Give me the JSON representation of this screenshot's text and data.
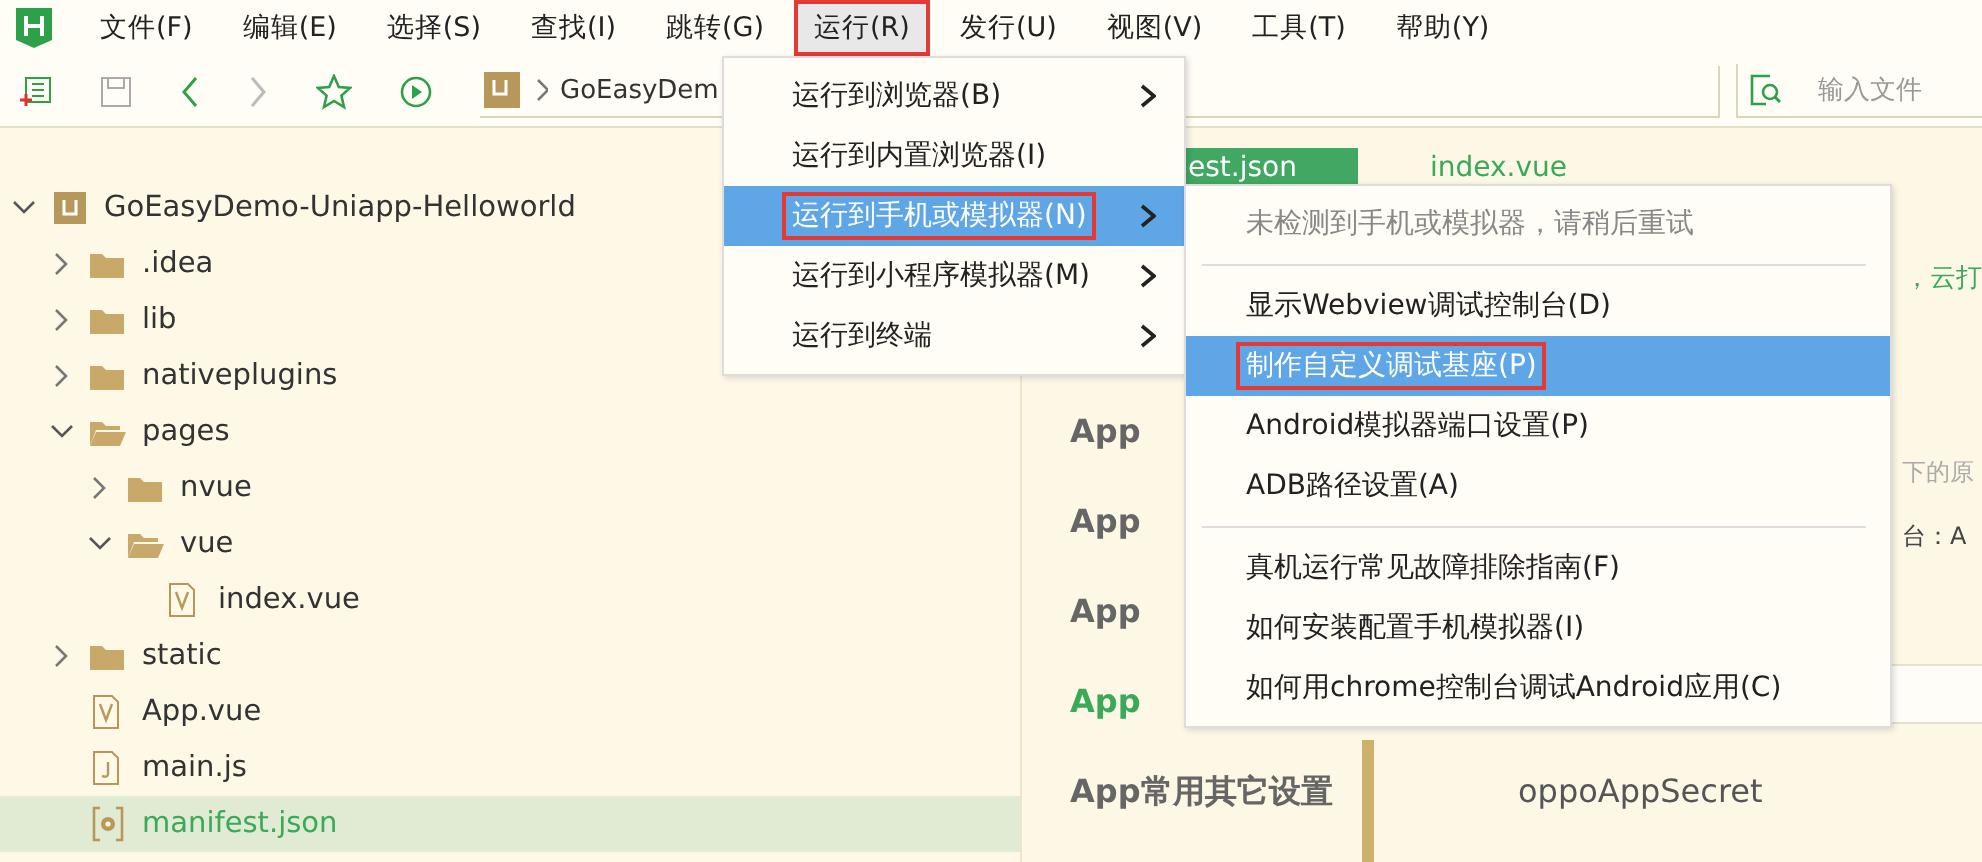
{
  "menubar": [
    {
      "label": "文件(F)",
      "selected": false,
      "highlighted": false
    },
    {
      "label": "编辑(E)",
      "selected": false,
      "highlighted": false
    },
    {
      "label": "选择(S)",
      "selected": false,
      "highlighted": false
    },
    {
      "label": "查找(I)",
      "selected": false,
      "highlighted": false
    },
    {
      "label": "跳转(G)",
      "selected": false,
      "highlighted": false
    },
    {
      "label": "运行(R)",
      "selected": true,
      "highlighted": true
    },
    {
      "label": "发行(U)",
      "selected": false,
      "highlighted": false
    },
    {
      "label": "视图(V)",
      "selected": false,
      "highlighted": false
    },
    {
      "label": "工具(T)",
      "selected": false,
      "highlighted": false
    },
    {
      "label": "帮助(Y)",
      "selected": false,
      "highlighted": false
    }
  ],
  "toolbar": {
    "breadcrumb": "GoEasyDem",
    "search": {
      "placeholder": "输入文件"
    }
  },
  "project_tree": [
    {
      "label": "GoEasyDemo-Uniapp-Helloworld",
      "kind": "project",
      "expanded": true,
      "selected": false,
      "children": [
        {
          "label": ".idea",
          "kind": "folder",
          "expanded": false,
          "selected": false
        },
        {
          "label": "lib",
          "kind": "folder",
          "expanded": false,
          "selected": false
        },
        {
          "label": "nativeplugins",
          "kind": "folder",
          "expanded": false,
          "selected": false
        },
        {
          "label": "pages",
          "kind": "folder",
          "expanded": true,
          "selected": false,
          "children": [
            {
              "label": "nvue",
              "kind": "folder",
              "expanded": false,
              "selected": false
            },
            {
              "label": "vue",
              "kind": "folder",
              "expanded": true,
              "selected": false,
              "children": [
                {
                  "label": "index.vue",
                  "kind": "vue",
                  "selected": false
                }
              ]
            }
          ]
        },
        {
          "label": "static",
          "kind": "folder",
          "expanded": false,
          "selected": false
        },
        {
          "label": "App.vue",
          "kind": "vue",
          "selected": false
        },
        {
          "label": "main.js",
          "kind": "script",
          "selected": false
        },
        {
          "label": "manifest.json",
          "kind": "config",
          "selected": true
        }
      ]
    }
  ],
  "editor": {
    "tabs": [
      {
        "label": "est.json",
        "selected": true
      },
      {
        "label": "index.vue",
        "selected": false
      }
    ],
    "sections": [
      {
        "label": "App",
        "selected": false
      },
      {
        "label": "App",
        "selected": false
      },
      {
        "label": "App",
        "selected": false
      },
      {
        "label": "App",
        "selected": true
      },
      {
        "label": "App常用其它设置",
        "selected": false
      }
    ],
    "content": [
      {
        "text": "，云打",
        "kind": "link"
      },
      {
        "text": "下的原",
        "kind": "hint"
      },
      {
        "text": "台：A",
        "kind": "text"
      }
    ],
    "field_label": "oppoAppSecret"
  },
  "run_menu": [
    {
      "label": "运行到浏览器(B)",
      "submenu": true,
      "selected": false,
      "highlighted": false
    },
    {
      "label": "运行到内置浏览器(I)",
      "submenu": false,
      "selected": false,
      "highlighted": false
    },
    {
      "label": "运行到手机或模拟器(N)",
      "submenu": true,
      "selected": true,
      "highlighted": true
    },
    {
      "label": "运行到小程序模拟器(M)",
      "submenu": true,
      "selected": false,
      "highlighted": false
    },
    {
      "label": "运行到终端",
      "submenu": true,
      "selected": false,
      "highlighted": false
    }
  ],
  "device_menu": [
    {
      "kind": "hint",
      "label": "未检测到手机或模拟器，请稍后重试"
    },
    {
      "kind": "separator"
    },
    {
      "kind": "item",
      "label": "显示Webview调试控制台(D)",
      "selected": false,
      "highlighted": false
    },
    {
      "kind": "item",
      "label": "制作自定义调试基座(P)",
      "selected": true,
      "highlighted": true
    },
    {
      "kind": "item",
      "label": "Android模拟器端口设置(P)",
      "selected": false,
      "highlighted": false
    },
    {
      "kind": "item",
      "label": "ADB路径设置(A)",
      "selected": false,
      "highlighted": false
    },
    {
      "kind": "separator"
    },
    {
      "kind": "item",
      "label": "真机运行常见故障排除指南(F)",
      "selected": false,
      "highlighted": false
    },
    {
      "kind": "item",
      "label": "如何安装配置手机模拟器(I)",
      "selected": false,
      "highlighted": false
    },
    {
      "kind": "item",
      "label": "如何用chrome控制台调试Android应用(C)",
      "selected": false,
      "highlighted": false
    }
  ]
}
